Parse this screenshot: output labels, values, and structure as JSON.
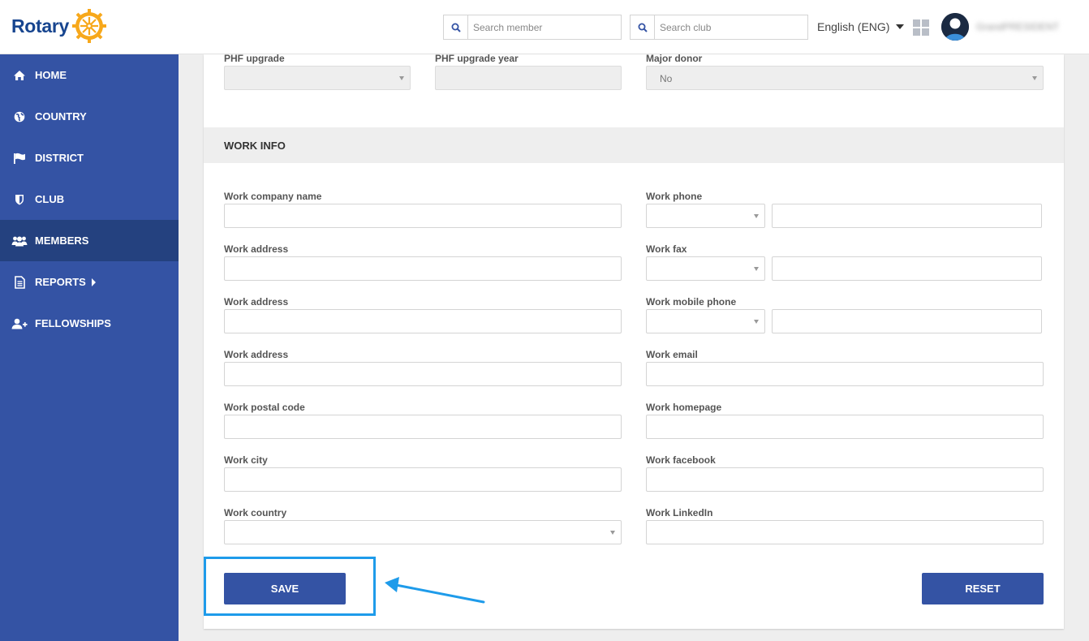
{
  "brand": {
    "name": "Rotary"
  },
  "header": {
    "search_member_placeholder": "Search member",
    "search_club_placeholder": "Search club",
    "language": "English (ENG)",
    "username": "GrandPRESIDENT"
  },
  "sidebar": {
    "items": [
      {
        "label": "HOME",
        "icon": "home-icon"
      },
      {
        "label": "COUNTRY",
        "icon": "globe-icon"
      },
      {
        "label": "DISTRICT",
        "icon": "flag-icon"
      },
      {
        "label": "CLUB",
        "icon": "shield-icon"
      },
      {
        "label": "MEMBERS",
        "icon": "users-icon",
        "active": true
      },
      {
        "label": "REPORTS",
        "icon": "document-icon",
        "has_submenu": true
      },
      {
        "label": "FELLOWSHIPS",
        "icon": "user-plus-icon"
      }
    ]
  },
  "top_fields": {
    "phf_upgrade": {
      "label": "PHF upgrade",
      "value": ""
    },
    "phf_upgrade_year": {
      "label": "PHF upgrade year",
      "value": ""
    },
    "major_donor": {
      "label": "Major donor",
      "value": "No"
    }
  },
  "work_info": {
    "title": "WORK INFO",
    "left": [
      {
        "label": "Work company name",
        "value": ""
      },
      {
        "label": "Work address",
        "value": ""
      },
      {
        "label": "Work address",
        "value": ""
      },
      {
        "label": "Work address",
        "value": ""
      },
      {
        "label": "Work postal code",
        "value": ""
      },
      {
        "label": "Work city",
        "value": ""
      },
      {
        "label": "Work country",
        "value": ""
      }
    ],
    "right": [
      {
        "label": "Work phone",
        "value": ""
      },
      {
        "label": "Work fax",
        "value": ""
      },
      {
        "label": "Work mobile phone",
        "value": ""
      },
      {
        "label": "Work email",
        "value": ""
      },
      {
        "label": "Work homepage",
        "value": ""
      },
      {
        "label": "Work facebook",
        "value": ""
      },
      {
        "label": "Work LinkedIn",
        "value": ""
      }
    ]
  },
  "actions": {
    "save_label": "SAVE",
    "reset_label": "RESET"
  },
  "colors": {
    "primary": "#3453a4",
    "sidebar_active": "#24417f",
    "brand_blue": "#17458f",
    "brand_gold": "#f7a81b",
    "highlight": "#1e9bea"
  }
}
